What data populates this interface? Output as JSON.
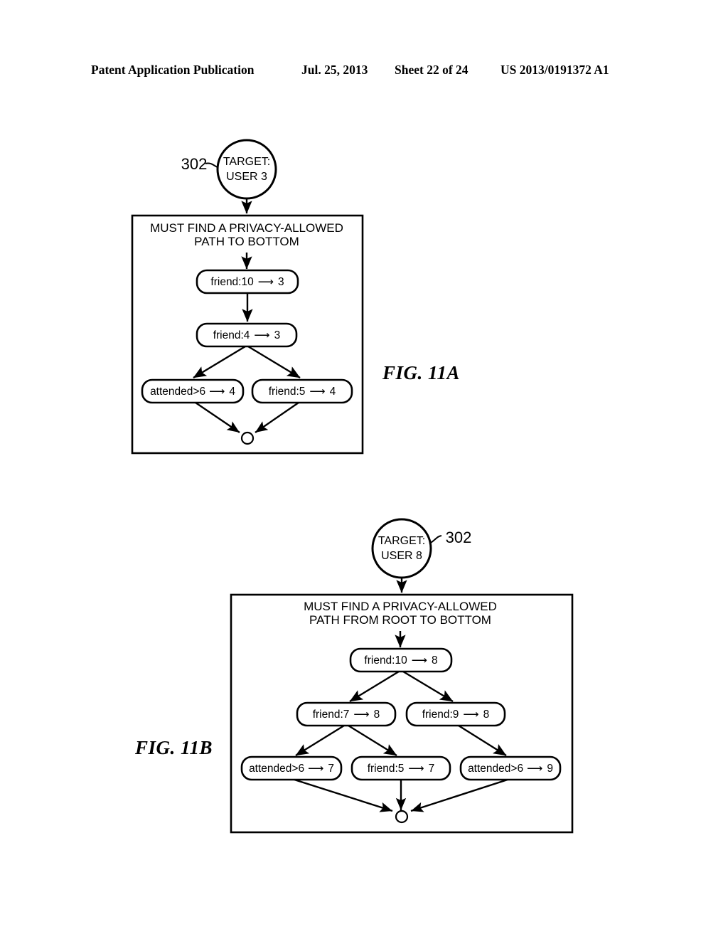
{
  "header": {
    "publication": "Patent Application Publication",
    "date": "Jul. 25, 2013",
    "sheet": "Sheet 22 of 24",
    "number": "US 2013/0191372 A1"
  },
  "figures": [
    {
      "id": "fig-11a",
      "label": "FIG. 11A",
      "reference_numeral": "302",
      "target": {
        "line1": "TARGET:",
        "line2": "USER 3"
      },
      "caption": {
        "line1": "MUST FIND A PRIVACY-ALLOWED",
        "line2": "PATH TO BOTTOM"
      },
      "nodes": [
        {
          "key": "a_n1",
          "label": "friend:10",
          "arrow": "⟶",
          "value": "3"
        },
        {
          "key": "a_n2",
          "label": "friend:4",
          "arrow": "⟶",
          "value": "3"
        },
        {
          "key": "a_n3",
          "label": "attended>6",
          "arrow": "⟶",
          "value": "4"
        },
        {
          "key": "a_n4",
          "label": "friend:5",
          "arrow": "⟶",
          "value": "4"
        }
      ],
      "sink": "terminal-node"
    },
    {
      "id": "fig-11b",
      "label": "FIG. 11B",
      "reference_numeral": "302",
      "target": {
        "line1": "TARGET:",
        "line2": "USER 8"
      },
      "caption": {
        "line1": "MUST FIND A PRIVACY-ALLOWED",
        "line2": "PATH FROM ROOT TO BOTTOM"
      },
      "nodes": [
        {
          "key": "b_n1",
          "label": "friend:10",
          "arrow": "⟶",
          "value": "8"
        },
        {
          "key": "b_n2",
          "label": "friend:7",
          "arrow": "⟶",
          "value": "8"
        },
        {
          "key": "b_n3",
          "label": "friend:9",
          "arrow": "⟶",
          "value": "8"
        },
        {
          "key": "b_n4",
          "label": "attended>6",
          "arrow": "⟶",
          "value": "7"
        },
        {
          "key": "b_n5",
          "label": "friend:5",
          "arrow": "⟶",
          "value": "7"
        },
        {
          "key": "b_n6",
          "label": "attended>6",
          "arrow": "⟶",
          "value": "9"
        }
      ],
      "sink": "terminal-node"
    }
  ],
  "colors": {
    "ink": "#000000",
    "paper": "#ffffff"
  }
}
